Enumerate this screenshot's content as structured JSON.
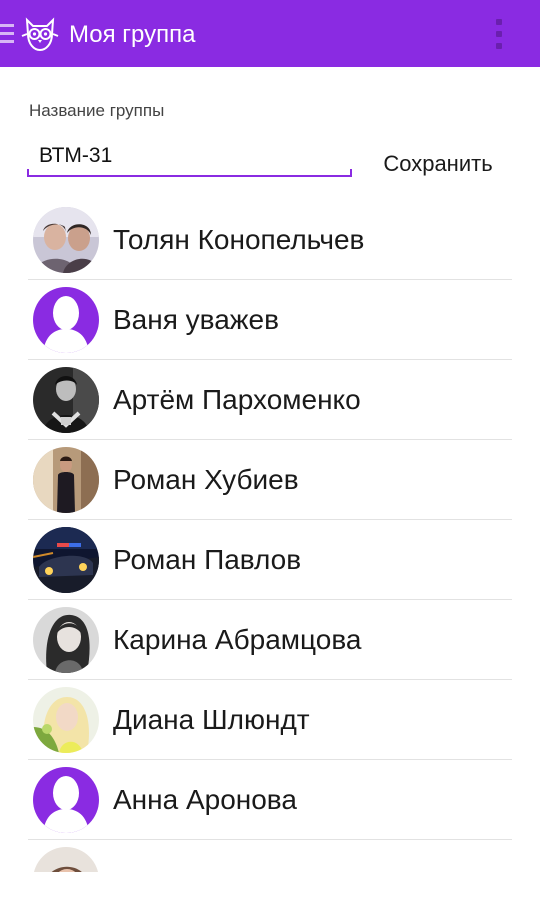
{
  "app_bar": {
    "title": "Моя группа",
    "icons": [
      "menu-icon",
      "owl-logo-icon",
      "overflow-menu-icon"
    ],
    "background": "#8a2be2"
  },
  "form": {
    "group_name_label": "Название группы",
    "group_name_value": "ВТМ-31",
    "save_label": "Сохранить",
    "accent_color": "#8a2be2"
  },
  "members": [
    {
      "name": "Толян Конопельчев",
      "avatar": "photo"
    },
    {
      "name": "Ваня уважев",
      "avatar": "placeholder"
    },
    {
      "name": "Артём Пархоменко",
      "avatar": "photo"
    },
    {
      "name": "Роман Хубиев",
      "avatar": "photo"
    },
    {
      "name": "Роман Павлов",
      "avatar": "photo"
    },
    {
      "name": "Карина Абрамцова",
      "avatar": "photo"
    },
    {
      "name": "Диана Шлюндт",
      "avatar": "photo"
    },
    {
      "name": "Анна Аронова",
      "avatar": "placeholder"
    },
    {
      "name": "",
      "avatar": "photo"
    }
  ]
}
